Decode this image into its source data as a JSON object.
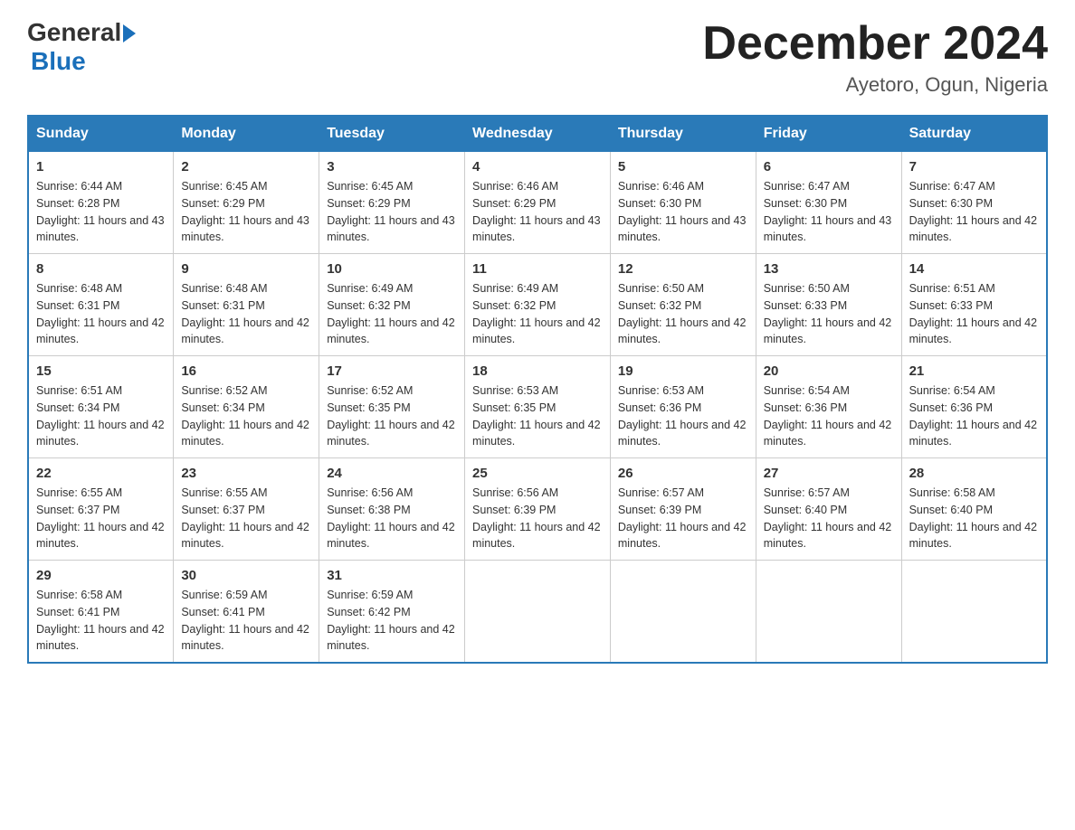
{
  "header": {
    "logo_general": "General",
    "logo_blue": "Blue",
    "month_title": "December 2024",
    "location": "Ayetoro, Ogun, Nigeria"
  },
  "weekdays": [
    "Sunday",
    "Monday",
    "Tuesday",
    "Wednesday",
    "Thursday",
    "Friday",
    "Saturday"
  ],
  "weeks": [
    [
      {
        "day": "1",
        "sunrise": "6:44 AM",
        "sunset": "6:28 PM",
        "daylight": "11 hours and 43 minutes."
      },
      {
        "day": "2",
        "sunrise": "6:45 AM",
        "sunset": "6:29 PM",
        "daylight": "11 hours and 43 minutes."
      },
      {
        "day": "3",
        "sunrise": "6:45 AM",
        "sunset": "6:29 PM",
        "daylight": "11 hours and 43 minutes."
      },
      {
        "day": "4",
        "sunrise": "6:46 AM",
        "sunset": "6:29 PM",
        "daylight": "11 hours and 43 minutes."
      },
      {
        "day": "5",
        "sunrise": "6:46 AM",
        "sunset": "6:30 PM",
        "daylight": "11 hours and 43 minutes."
      },
      {
        "day": "6",
        "sunrise": "6:47 AM",
        "sunset": "6:30 PM",
        "daylight": "11 hours and 43 minutes."
      },
      {
        "day": "7",
        "sunrise": "6:47 AM",
        "sunset": "6:30 PM",
        "daylight": "11 hours and 42 minutes."
      }
    ],
    [
      {
        "day": "8",
        "sunrise": "6:48 AM",
        "sunset": "6:31 PM",
        "daylight": "11 hours and 42 minutes."
      },
      {
        "day": "9",
        "sunrise": "6:48 AM",
        "sunset": "6:31 PM",
        "daylight": "11 hours and 42 minutes."
      },
      {
        "day": "10",
        "sunrise": "6:49 AM",
        "sunset": "6:32 PM",
        "daylight": "11 hours and 42 minutes."
      },
      {
        "day": "11",
        "sunrise": "6:49 AM",
        "sunset": "6:32 PM",
        "daylight": "11 hours and 42 minutes."
      },
      {
        "day": "12",
        "sunrise": "6:50 AM",
        "sunset": "6:32 PM",
        "daylight": "11 hours and 42 minutes."
      },
      {
        "day": "13",
        "sunrise": "6:50 AM",
        "sunset": "6:33 PM",
        "daylight": "11 hours and 42 minutes."
      },
      {
        "day": "14",
        "sunrise": "6:51 AM",
        "sunset": "6:33 PM",
        "daylight": "11 hours and 42 minutes."
      }
    ],
    [
      {
        "day": "15",
        "sunrise": "6:51 AM",
        "sunset": "6:34 PM",
        "daylight": "11 hours and 42 minutes."
      },
      {
        "day": "16",
        "sunrise": "6:52 AM",
        "sunset": "6:34 PM",
        "daylight": "11 hours and 42 minutes."
      },
      {
        "day": "17",
        "sunrise": "6:52 AM",
        "sunset": "6:35 PM",
        "daylight": "11 hours and 42 minutes."
      },
      {
        "day": "18",
        "sunrise": "6:53 AM",
        "sunset": "6:35 PM",
        "daylight": "11 hours and 42 minutes."
      },
      {
        "day": "19",
        "sunrise": "6:53 AM",
        "sunset": "6:36 PM",
        "daylight": "11 hours and 42 minutes."
      },
      {
        "day": "20",
        "sunrise": "6:54 AM",
        "sunset": "6:36 PM",
        "daylight": "11 hours and 42 minutes."
      },
      {
        "day": "21",
        "sunrise": "6:54 AM",
        "sunset": "6:36 PM",
        "daylight": "11 hours and 42 minutes."
      }
    ],
    [
      {
        "day": "22",
        "sunrise": "6:55 AM",
        "sunset": "6:37 PM",
        "daylight": "11 hours and 42 minutes."
      },
      {
        "day": "23",
        "sunrise": "6:55 AM",
        "sunset": "6:37 PM",
        "daylight": "11 hours and 42 minutes."
      },
      {
        "day": "24",
        "sunrise": "6:56 AM",
        "sunset": "6:38 PM",
        "daylight": "11 hours and 42 minutes."
      },
      {
        "day": "25",
        "sunrise": "6:56 AM",
        "sunset": "6:39 PM",
        "daylight": "11 hours and 42 minutes."
      },
      {
        "day": "26",
        "sunrise": "6:57 AM",
        "sunset": "6:39 PM",
        "daylight": "11 hours and 42 minutes."
      },
      {
        "day": "27",
        "sunrise": "6:57 AM",
        "sunset": "6:40 PM",
        "daylight": "11 hours and 42 minutes."
      },
      {
        "day": "28",
        "sunrise": "6:58 AM",
        "sunset": "6:40 PM",
        "daylight": "11 hours and 42 minutes."
      }
    ],
    [
      {
        "day": "29",
        "sunrise": "6:58 AM",
        "sunset": "6:41 PM",
        "daylight": "11 hours and 42 minutes."
      },
      {
        "day": "30",
        "sunrise": "6:59 AM",
        "sunset": "6:41 PM",
        "daylight": "11 hours and 42 minutes."
      },
      {
        "day": "31",
        "sunrise": "6:59 AM",
        "sunset": "6:42 PM",
        "daylight": "11 hours and 42 minutes."
      },
      null,
      null,
      null,
      null
    ]
  ]
}
